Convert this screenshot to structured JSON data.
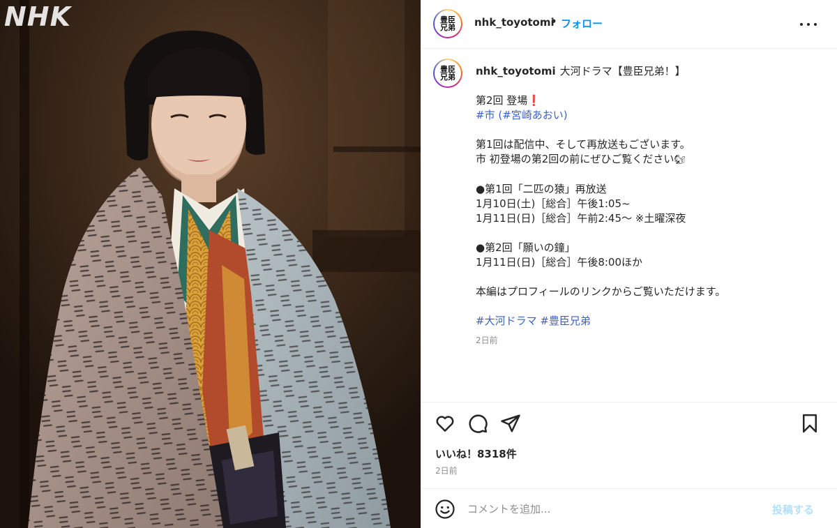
{
  "photo": {
    "watermark": "NHK",
    "avatar_text": "豊臣兄弟"
  },
  "header": {
    "username": "nhk_toyotomi",
    "separator": "•",
    "follow_label": "フォロー",
    "more_icon": "more-horizontal-icon"
  },
  "caption": {
    "username": "nhk_toyotomi",
    "title": "大河ドラマ【豊臣兄弟！】",
    "lines": [
      "第2回 登場",
      "",
      "",
      "第1回は配信中、そして再放送もございます。",
      "市 初登場の第2回の前にぜひご覧ください",
      "",
      "●第1回「二匹の猿」再放送",
      "1月10日(土)［総合］午後1:05~",
      "1月11日(日)［総合］午前2:45〜 ※土曜深夜",
      "",
      "●第2回「願いの鐘」",
      "1月11日(日)［総合］午後8:00ほか",
      "",
      "本編はプロフィールのリンクからご覧いただけます。",
      ""
    ],
    "exclaim": "❗",
    "tag_line": {
      "tag1": "#市",
      "open": " (",
      "tag2": "#宮崎あおい",
      "close": ")"
    },
    "squirrel": "🐿",
    "hashtags": [
      "#大河ドラマ",
      "#豊臣兄弟"
    ],
    "time": "2日前"
  },
  "actions": {
    "icons": [
      "heart-icon",
      "comment-icon",
      "share-icon",
      "bookmark-icon"
    ]
  },
  "likes": "いいね！8318件",
  "posted": "2日前",
  "comment": {
    "placeholder": "コメントを追加...",
    "post_label": "投稿する"
  },
  "colors": {
    "link": "#3b5fcf",
    "follow": "#0095f6",
    "post_disabled": "#b2dffc"
  }
}
